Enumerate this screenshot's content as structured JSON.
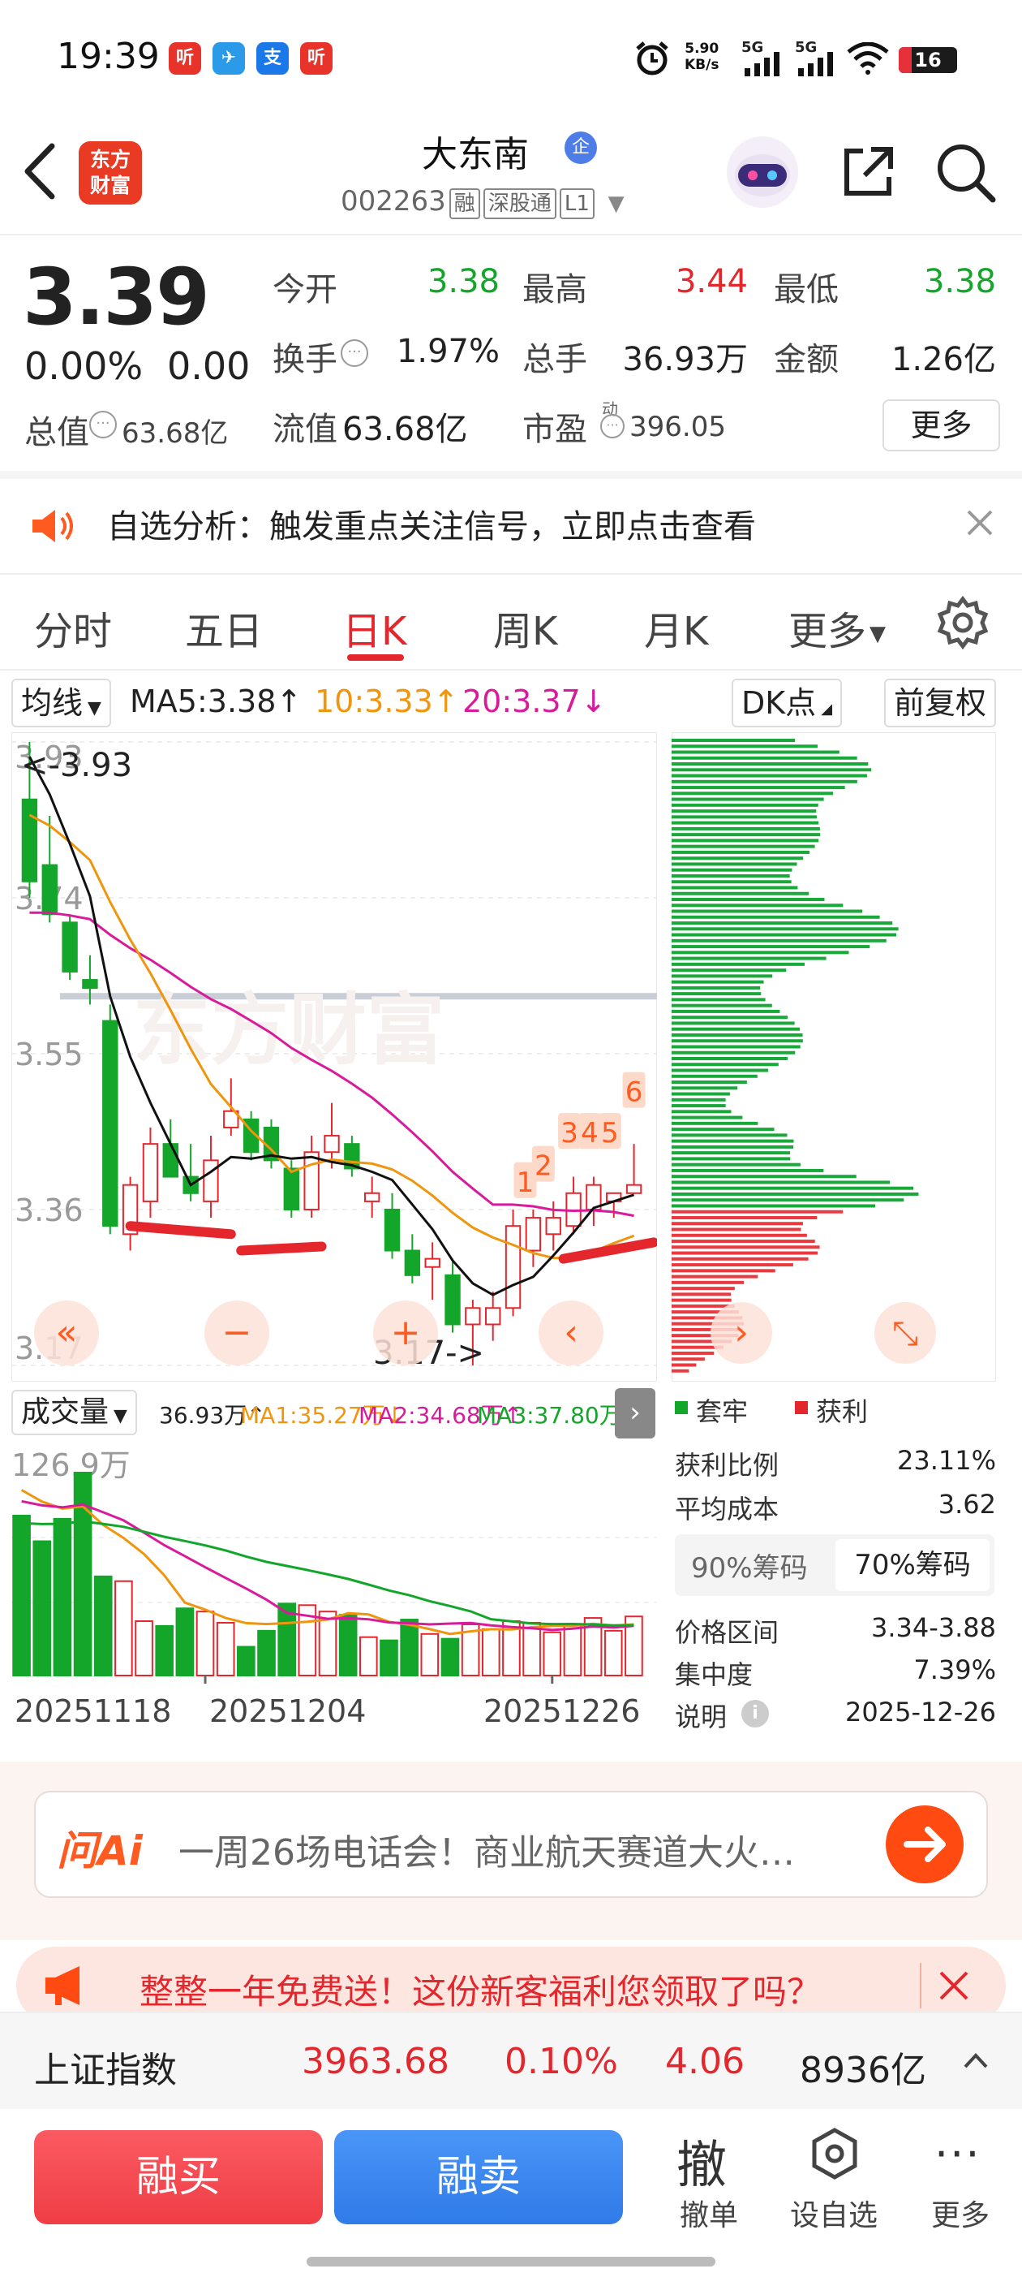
{
  "status": {
    "time": "19:39",
    "net_speed": "5.90",
    "net_unit": "KB/s",
    "signal1": "5G",
    "signal2": "5G",
    "battery": "16",
    "app_icons": [
      "听",
      "✈",
      "支",
      "听"
    ]
  },
  "header": {
    "logo": "东方财富",
    "name": "大东南",
    "name_badge": "企",
    "code": "002263",
    "tags": [
      "融",
      "深股通",
      "L1"
    ]
  },
  "quote": {
    "price": "3.39",
    "change_pct": "0.00%",
    "change": "0.00",
    "open_label": "今开",
    "open": "3.38",
    "high_label": "最高",
    "high": "3.44",
    "low_label": "最低",
    "low": "3.38",
    "turnover_label": "换手",
    "turnover": "1.97%",
    "volume_label": "总手",
    "volume": "36.93万",
    "amount_label": "金额",
    "amount": "1.26亿",
    "mktcap_label": "总值",
    "mktcap": "63.68亿",
    "float_label": "流值",
    "float": "63.68亿",
    "pe_label": "市盈",
    "pe_sup": "动",
    "pe": "396.05",
    "more": "更多"
  },
  "notice": {
    "text": "自选分析：触发重点关注信号，立即点击查看"
  },
  "tabs": [
    "分时",
    "五日",
    "日K",
    "周K",
    "月K",
    "更多"
  ],
  "tab_active": 2,
  "chart_header": {
    "ma_select": "均线",
    "ma5": "MA5:3.38",
    "ma10": "10:3.33",
    "ma20": "20:3.37",
    "dk": "DK点",
    "adjust": "前复权"
  },
  "kline": {
    "y_labels": [
      "3.93",
      "3.74",
      "3.55",
      "3.36",
      "3.17"
    ],
    "max_annot": "<-3.93",
    "min_annot": "3.17->",
    "watermark": "东方财富",
    "markers": [
      "1",
      "2",
      "3",
      "4",
      "5",
      "6"
    ]
  },
  "volume": {
    "select": "成交量",
    "vol": "36.93万",
    "ma1": "MA1:35.27万",
    "ma2": "MA2:34.68万",
    "ma3": "MA3:37.80万",
    "top_label": "126.9万",
    "dates": [
      "20251118",
      "20251204",
      "20251226"
    ]
  },
  "chips": {
    "legend_trapped": "套牢",
    "legend_profit": "获利",
    "profit_ratio_label": "获利比例",
    "profit_ratio": "23.11%",
    "avg_cost_label": "平均成本",
    "avg_cost": "3.62",
    "tab90": "90%筹码",
    "tab70": "70%筹码",
    "range_label": "价格区间",
    "range": "3.34-3.88",
    "concentration_label": "集中度",
    "concentration": "7.39%",
    "note_label": "说明",
    "note_date": "2025-12-26"
  },
  "ai": {
    "label": "问Ai",
    "text": "一周26场电话会！商业航天赛道大火…"
  },
  "promo": {
    "text": "整整一年免费送！这份新客福利您领取了吗？"
  },
  "index": {
    "name": "上证指数",
    "value": "3963.68",
    "pct": "0.10%",
    "change": "4.06",
    "amount": "8936亿"
  },
  "actions": {
    "buy": "融买",
    "sell": "融卖",
    "cancel_glyph": "撤",
    "cancel": "撤单",
    "set_watch": "设自选",
    "more": "更多"
  },
  "colors": {
    "up": "#e4262d",
    "down": "#14a52b",
    "ma5": "#111111",
    "ma10": "#f0960e",
    "ma20": "#d81b9b"
  },
  "chart_data": {
    "type": "candlestick",
    "dates": [
      "20251118",
      "20251204",
      "20251226"
    ],
    "ylim": [
      3.17,
      3.93
    ],
    "candles": [
      {
        "o": 3.86,
        "h": 3.93,
        "l": 3.74,
        "c": 3.76
      },
      {
        "o": 3.78,
        "h": 3.84,
        "l": 3.71,
        "c": 3.72
      },
      {
        "o": 3.71,
        "h": 3.72,
        "l": 3.64,
        "c": 3.65
      },
      {
        "o": 3.64,
        "h": 3.67,
        "l": 3.61,
        "c": 3.63
      },
      {
        "o": 3.59,
        "h": 3.61,
        "l": 3.33,
        "c": 3.34
      },
      {
        "o": 3.33,
        "h": 3.4,
        "l": 3.31,
        "c": 3.39
      },
      {
        "o": 3.37,
        "h": 3.46,
        "l": 3.35,
        "c": 3.44
      },
      {
        "o": 3.44,
        "h": 3.47,
        "l": 3.4,
        "c": 3.4
      },
      {
        "o": 3.4,
        "h": 3.44,
        "l": 3.37,
        "c": 3.38
      },
      {
        "o": 3.37,
        "h": 3.45,
        "l": 3.35,
        "c": 3.42
      },
      {
        "o": 3.46,
        "h": 3.52,
        "l": 3.45,
        "c": 3.48
      },
      {
        "o": 3.47,
        "h": 3.48,
        "l": 3.42,
        "c": 3.43
      },
      {
        "o": 3.46,
        "h": 3.47,
        "l": 3.41,
        "c": 3.42
      },
      {
        "o": 3.41,
        "h": 3.42,
        "l": 3.35,
        "c": 3.36
      },
      {
        "o": 3.36,
        "h": 3.45,
        "l": 3.35,
        "c": 3.43
      },
      {
        "o": 3.43,
        "h": 3.49,
        "l": 3.41,
        "c": 3.45
      },
      {
        "o": 3.44,
        "h": 3.45,
        "l": 3.4,
        "c": 3.41
      },
      {
        "o": 3.37,
        "h": 3.4,
        "l": 3.35,
        "c": 3.38
      },
      {
        "o": 3.36,
        "h": 3.38,
        "l": 3.3,
        "c": 3.31
      },
      {
        "o": 3.31,
        "h": 3.33,
        "l": 3.27,
        "c": 3.28
      },
      {
        "o": 3.29,
        "h": 3.32,
        "l": 3.25,
        "c": 3.3
      },
      {
        "o": 3.28,
        "h": 3.3,
        "l": 3.21,
        "c": 3.22
      },
      {
        "o": 3.22,
        "h": 3.25,
        "l": 3.17,
        "c": 3.24
      },
      {
        "o": 3.22,
        "h": 3.26,
        "l": 3.2,
        "c": 3.24
      },
      {
        "o": 3.24,
        "h": 3.36,
        "l": 3.23,
        "c": 3.34
      },
      {
        "o": 3.31,
        "h": 3.36,
        "l": 3.29,
        "c": 3.35
      },
      {
        "o": 3.33,
        "h": 3.37,
        "l": 3.31,
        "c": 3.35
      },
      {
        "o": 3.34,
        "h": 3.4,
        "l": 3.33,
        "c": 3.38
      },
      {
        "o": 3.36,
        "h": 3.4,
        "l": 3.34,
        "c": 3.39
      },
      {
        "o": 3.37,
        "h": 3.38,
        "l": 3.35,
        "c": 3.38
      },
      {
        "o": 3.38,
        "h": 3.44,
        "l": 3.38,
        "c": 3.39
      }
    ],
    "volume": [
      100,
      84,
      98,
      126.9,
      62,
      59,
      34,
      31,
      42,
      40,
      33,
      18,
      28,
      45,
      44,
      40,
      38,
      24,
      22,
      35,
      26,
      23,
      32,
      29,
      34,
      33,
      27,
      32,
      36,
      28,
      36.93
    ],
    "volume_top": 126.9,
    "chip_distribution": {
      "price_range": [
        3.17,
        3.93
      ],
      "profit_ratio": 23.11,
      "avg_cost": 3.62
    }
  }
}
